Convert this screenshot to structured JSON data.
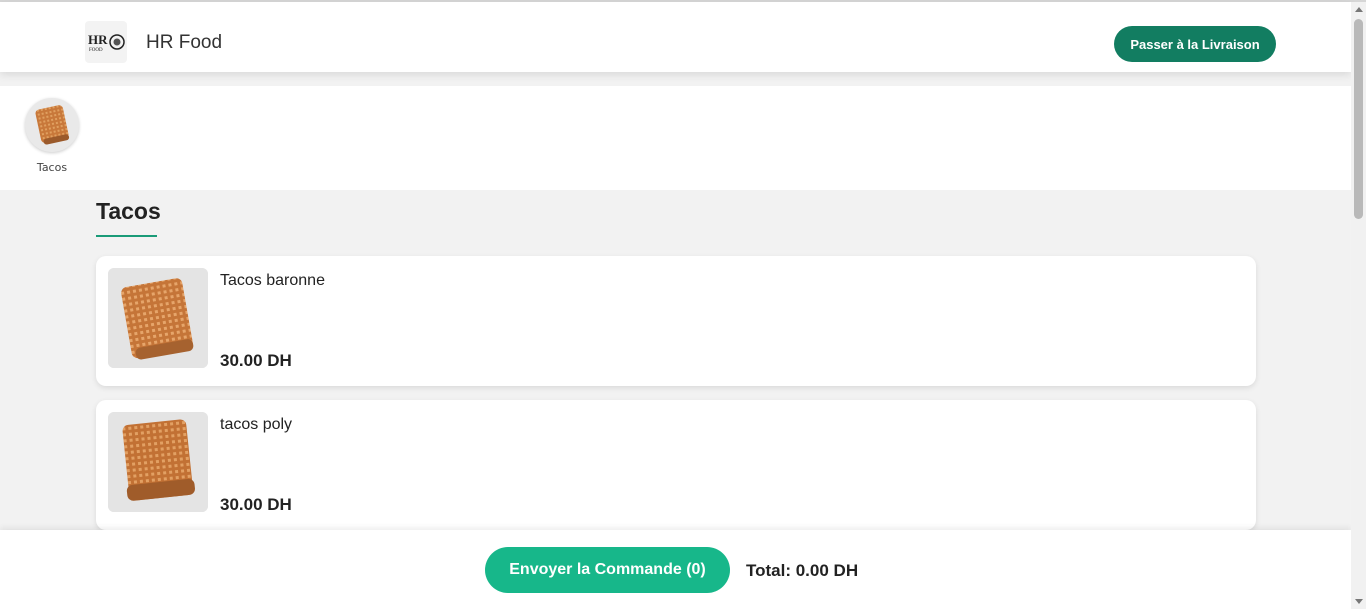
{
  "header": {
    "brand_name": "HR Food",
    "logo_text": "HR",
    "delivery_button_label": "Passer à la Livraison"
  },
  "categories": [
    {
      "label": "Tacos"
    }
  ],
  "section": {
    "title": "Tacos"
  },
  "products": [
    {
      "name": "Tacos baronne",
      "price": "30.00 DH"
    },
    {
      "name": "tacos poly",
      "price": "30.00 DH"
    }
  ],
  "footer": {
    "order_button_label": "Envoyer la Commande (0)",
    "total_label": "Total: 0.00 DH"
  },
  "colors": {
    "primary_dark": "#127d61",
    "primary": "#17b78a",
    "accent_underline": "#1a9b78"
  }
}
